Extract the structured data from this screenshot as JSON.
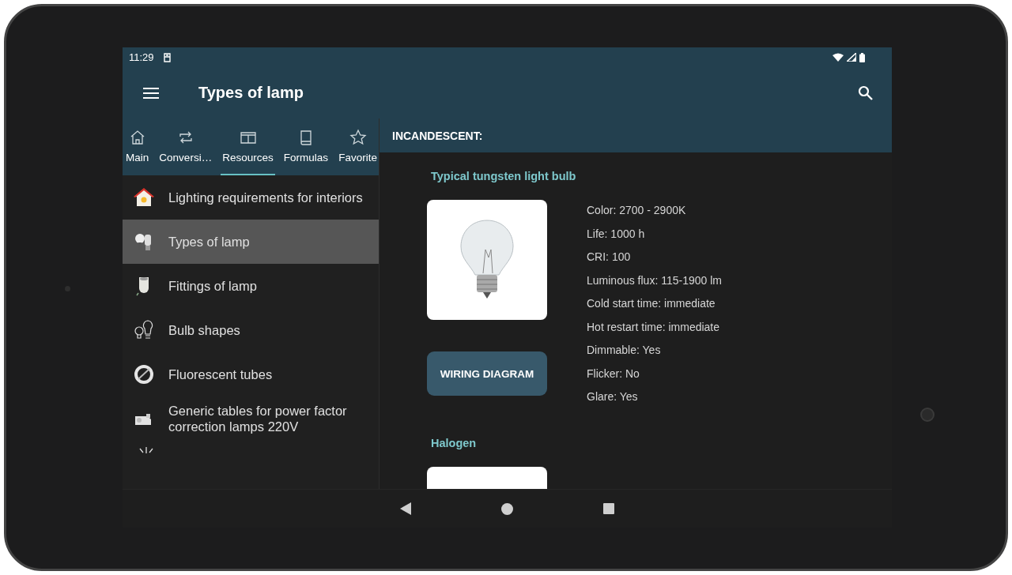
{
  "status_bar": {
    "time": "11:29"
  },
  "app_bar": {
    "title": "Types of lamp"
  },
  "tabs": [
    {
      "label": "Main",
      "selected": false
    },
    {
      "label": "Conversi…",
      "selected": false
    },
    {
      "label": "Resources",
      "selected": true
    },
    {
      "label": "Formulas",
      "selected": false
    },
    {
      "label": "Favorite",
      "selected": false
    }
  ],
  "sidebar": {
    "items": [
      {
        "label": "Lighting requirements for interiors",
        "selected": false
      },
      {
        "label": "Types of lamp",
        "selected": true
      },
      {
        "label": "Fittings of lamp",
        "selected": false
      },
      {
        "label": "Bulb shapes",
        "selected": false
      },
      {
        "label": "Fluorescent tubes",
        "selected": false
      },
      {
        "label": "Generic tables for power factor correction lamps 220V",
        "selected": false
      }
    ]
  },
  "content": {
    "section": "INCANDESCENT:",
    "lamps": [
      {
        "title": "Typical tungsten light bulb",
        "button": "WIRING DIAGRAM",
        "specs": [
          "Color: 2700 - 2900K",
          "Life: 1000 h",
          "CRI: 100",
          "Luminous flux: 115-1900 lm",
          "Cold start time: immediate",
          "Hot restart time: immediate",
          "Dimmable: Yes",
          "Flicker: No",
          "Glare: Yes"
        ]
      },
      {
        "title": "Halogen"
      }
    ]
  }
}
